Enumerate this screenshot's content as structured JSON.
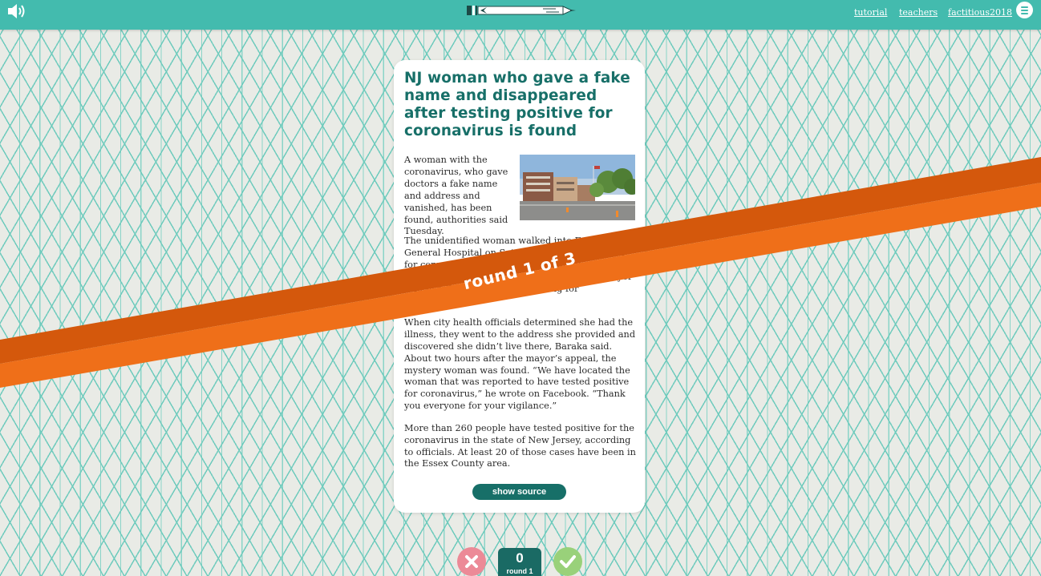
{
  "nav": {
    "links": [
      "tutorial",
      "teachers",
      "factitious2018"
    ]
  },
  "icons": {
    "sound": "speaker-icon",
    "menu": "hamburger-menu-icon",
    "logo": "pencil-logo",
    "false": "x-icon",
    "true": "check-icon"
  },
  "article": {
    "headline": "NJ woman who gave a fake name and disappeared after testing positive for coronavirus is found",
    "paragraphs": [
      "A woman with the coronavirus, who gave doctors a fake name and address and vanished, has been found, authorities said Tuesday.",
      "The unidentified woman walked into East Orange General Hospital on Saturday, where she tested for coronavirus. Mayor Ras Baraka released a photo of her from the security footage, the mayor said in a Facebook video, pleading for information.",
      "When city health officials determined she had the illness, they went to the address she provided and discovered she didn’t live there, Baraka said. About two hours after the mayor’s appeal, the mystery woman was found. “We have located the woman that was reported to have tested positive for coronavirus,” he wrote on Facebook. “Thank you everyone for your vigilance.”",
      "More than 260 people have tested positive for the coronavirus in the state of New Jersey, according to officials. At least 20 of those cases have been in the Essex County area."
    ],
    "show_source_label": "show source"
  },
  "banner": {
    "text": "round 1 of 3"
  },
  "score": {
    "value": "0",
    "round_label": "round 1"
  },
  "colors": {
    "topbar": "#43bbae",
    "headline": "#176f68",
    "banner_dark": "#d4580c",
    "banner_light": "#ef6f19",
    "false_button": "#ec8a97",
    "true_button": "#99d17a",
    "score_box": "#1a6a64"
  }
}
